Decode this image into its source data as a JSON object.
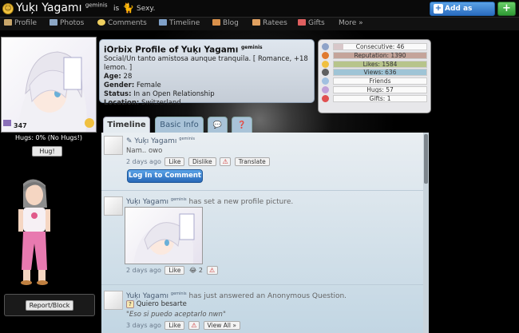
{
  "header": {
    "username": "Yuķı Yagamı",
    "user_tag": "geminis",
    "is_text": "is",
    "mood": "Sexy.",
    "add_friend": "Add as Friend",
    "plus": "+"
  },
  "nav": [
    {
      "label": "Profile",
      "color": "#c9a66b"
    },
    {
      "label": "Photos",
      "color": "#8ca7c6"
    },
    {
      "label": "Comments",
      "color": "#f0d060"
    },
    {
      "label": "Timeline",
      "color": "#7fa0c8"
    },
    {
      "label": "Blog",
      "color": "#d9904a"
    },
    {
      "label": "Ratees",
      "color": "#e0a060"
    },
    {
      "label": "Gifts",
      "color": "#e06060"
    },
    {
      "label": "More »",
      "color": ""
    }
  ],
  "left": {
    "points": "347",
    "hugs": "Hugs: 0% (No Hugs!)",
    "hug_btn": "Hug!",
    "report": "Report/Block"
  },
  "profile": {
    "title": "iOrbix Profile of Yuķı Yagamı",
    "title_tag": "geminis",
    "tagline": "Social/Un tanto amistosa aunque tranquila. [ Romance, +18 lemon. ]",
    "rows": [
      {
        "k": "Age:",
        "v": "28"
      },
      {
        "k": "Gender:",
        "v": "Female"
      },
      {
        "k": "Status:",
        "v": "In an Open Relationship"
      },
      {
        "k": "Location:",
        "v": "Switzerland"
      }
    ]
  },
  "stats": [
    {
      "label": "Consecutive: 46",
      "fill": 0.1,
      "color": "#d8c7c9",
      "icon": "#8fa3c8"
    },
    {
      "label": "Reputation: 1390",
      "fill": 1.0,
      "color": "#c4a49a",
      "icon": "#e07a30"
    },
    {
      "label": "Likes: 1584",
      "fill": 1.0,
      "color": "#b7c48b",
      "icon": "#f0c040"
    },
    {
      "label": "Views: 636",
      "fill": 1.0,
      "color": "#9fc4d6",
      "icon": "#606060"
    },
    {
      "label": "Friends",
      "fill": 0,
      "color": "#ccc",
      "icon": "#a0c0e0"
    },
    {
      "label": "Hugs: 57",
      "fill": 0,
      "color": "#ccc",
      "icon": "#c0a0d8"
    },
    {
      "label": "Gifts: 1",
      "fill": 0,
      "color": "#ccc",
      "icon": "#e05050"
    }
  ],
  "tabs": {
    "timeline": "Timeline",
    "basic": "Basic Info",
    "chat": "💬",
    "question": "❓"
  },
  "posts": [
    {
      "name": "Yuķı Yagamı",
      "tag": "geminis",
      "text": "Nam.. owo",
      "time": "2 days ago",
      "like": "Like",
      "dislike": "Dislike",
      "warn": "⚠",
      "translate": "Translate",
      "login": "Log In to Comment"
    },
    {
      "name": "Yuķı Yagamı",
      "tag": "geminis",
      "action": "has set a new profile picture.",
      "time": "2 days ago",
      "like": "Like",
      "emoji": "😂",
      "count": "2",
      "warn": "⚠"
    },
    {
      "name": "Yuķı Yagamı",
      "tag": "geminis",
      "action": "has just answered an Anonymous Question.",
      "question": "Quiero besarte",
      "answer": "\"Eso si puedo aceptarlo nwn\"",
      "time": "3 days ago",
      "like": "Like",
      "warn": "⚠",
      "viewall": "View All »"
    }
  ]
}
